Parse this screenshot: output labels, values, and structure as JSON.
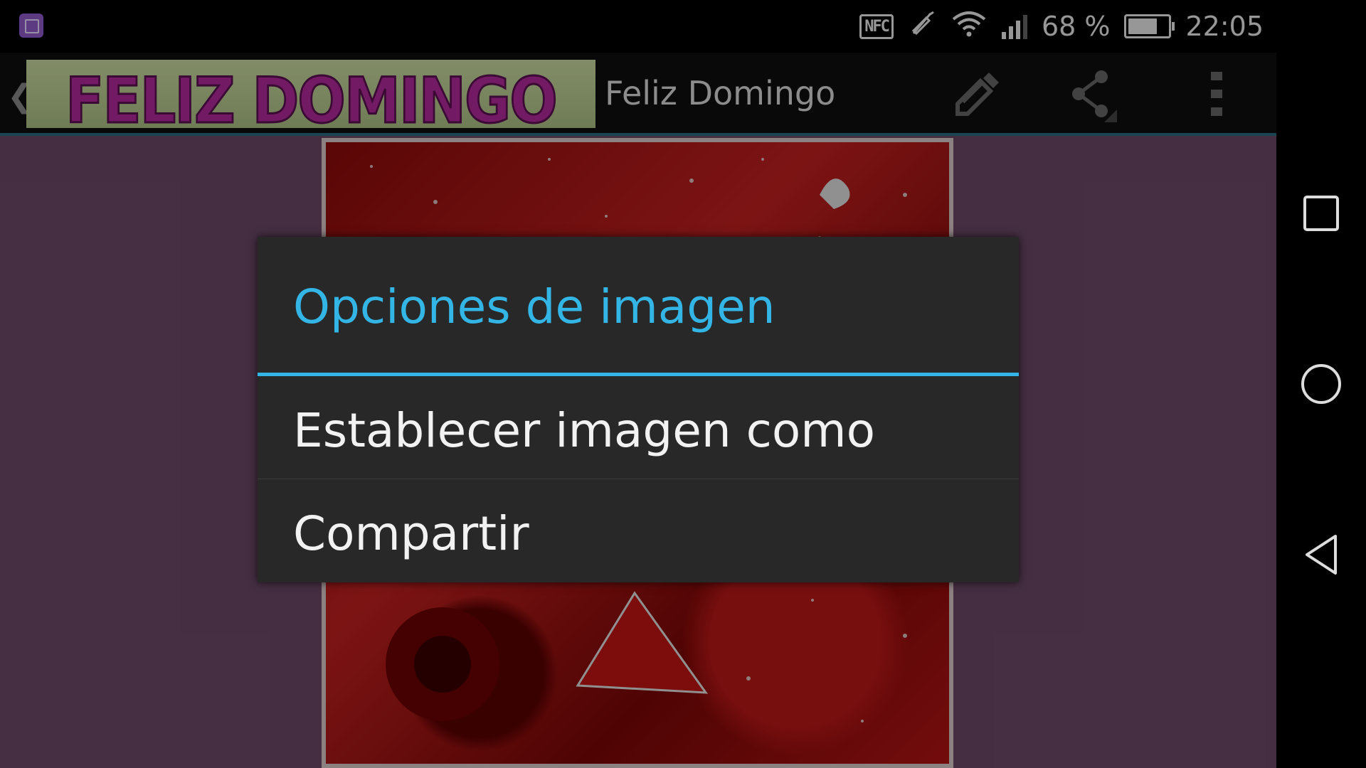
{
  "status_bar": {
    "battery_percent": "68 %",
    "time": "22:05",
    "nfc_label": "NFC",
    "icons": [
      "app-notification-icon",
      "nfc-icon",
      "vibrate-off-icon",
      "wifi-icon",
      "signal-icon",
      "battery-icon"
    ]
  },
  "action_bar": {
    "banner_text": "FELIZ DOMINGO",
    "title": "Feliz Domingo",
    "icons": [
      "back-chevron-icon",
      "edit-icon",
      "share-icon",
      "overflow-menu-icon"
    ]
  },
  "dialog": {
    "title": "Opciones de imagen",
    "items": [
      {
        "label": "Establecer imagen como"
      },
      {
        "label": "Compartir"
      }
    ]
  },
  "nav_bar": {
    "icons": [
      "recents-icon",
      "home-icon",
      "back-icon"
    ]
  },
  "colors": {
    "accent": "#33b5e5",
    "dialog_bg": "#282828",
    "content_bg": "#6b4866",
    "banner_text": "#b02a9a"
  }
}
